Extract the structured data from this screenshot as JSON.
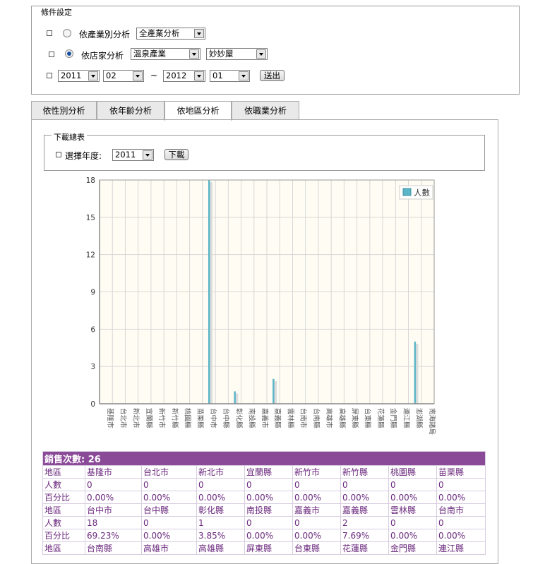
{
  "conditions": {
    "legend": "條件設定",
    "row1": {
      "label": "依產業別分析",
      "select": "全產業分析"
    },
    "row2": {
      "label": "依店家分析",
      "select1": "溫泉產業",
      "select2": "妙妙屋"
    },
    "row3": {
      "year_from": "2011",
      "month_from": "02",
      "tilde": "~",
      "year_to": "2012",
      "month_to": "01",
      "submit": "送出"
    }
  },
  "tabs": [
    "依性別分析",
    "依年齡分析",
    "依地區分析",
    "依職業分析"
  ],
  "active_tab": 2,
  "download": {
    "legend": "下載總表",
    "label": "選擇年度:",
    "year": "2011",
    "button": "下載"
  },
  "chart_data": {
    "type": "bar",
    "categories": [
      "基隆市",
      "台北市",
      "新北市",
      "宜蘭縣",
      "新竹市",
      "新竹縣",
      "桃園縣",
      "苗栗縣",
      "台中市",
      "台中縣",
      "彰化縣",
      "南投縣",
      "嘉義市",
      "嘉義縣",
      "雲林縣",
      "台南市",
      "台南縣",
      "高雄市",
      "高雄縣",
      "屏東縣",
      "台東縣",
      "花蓮縣",
      "金門縣",
      "連江縣",
      "澎湖縣",
      "南海諸島"
    ],
    "series": [
      {
        "name": "人數",
        "values": [
          0,
          0,
          0,
          0,
          0,
          0,
          0,
          0,
          18,
          0,
          1,
          0,
          0,
          2,
          0,
          0,
          0,
          0,
          0,
          0,
          0,
          0,
          0,
          0,
          5,
          0
        ]
      }
    ],
    "ylim": [
      0,
      18
    ],
    "yticks": [
      "0",
      "3",
      "6",
      "9",
      "12",
      "15",
      "18"
    ],
    "grid": true,
    "legend_position": "top-right",
    "colors": {
      "bar": "#5bb5c8",
      "shadow": "#dcdcdc",
      "plot_bg": "#fffdf3"
    }
  },
  "sales": {
    "title": "銷售次數: 26",
    "rows": [
      [
        "地區",
        "基隆市",
        "台北市",
        "新北市",
        "宜蘭縣",
        "新竹市",
        "新竹縣",
        "桃園縣",
        "苗栗縣"
      ],
      [
        "人數",
        "0",
        "0",
        "0",
        "0",
        "0",
        "0",
        "0",
        "0"
      ],
      [
        "百分比",
        "0.00%",
        "0.00%",
        "0.00%",
        "0.00%",
        "0.00%",
        "0.00%",
        "0.00%",
        "0.00%"
      ],
      [
        "地區",
        "台中市",
        "台中縣",
        "彰化縣",
        "南投縣",
        "嘉義市",
        "嘉義縣",
        "雲林縣",
        "台南市"
      ],
      [
        "人數",
        "18",
        "0",
        "1",
        "0",
        "0",
        "2",
        "0",
        "0"
      ],
      [
        "百分比",
        "69.23%",
        "0.00%",
        "3.85%",
        "0.00%",
        "0.00%",
        "7.69%",
        "0.00%",
        "0.00%"
      ],
      [
        "地區",
        "台南縣",
        "高雄市",
        "高雄縣",
        "屏東縣",
        "台東縣",
        "花蓮縣",
        "金門縣",
        "連江縣"
      ]
    ]
  }
}
